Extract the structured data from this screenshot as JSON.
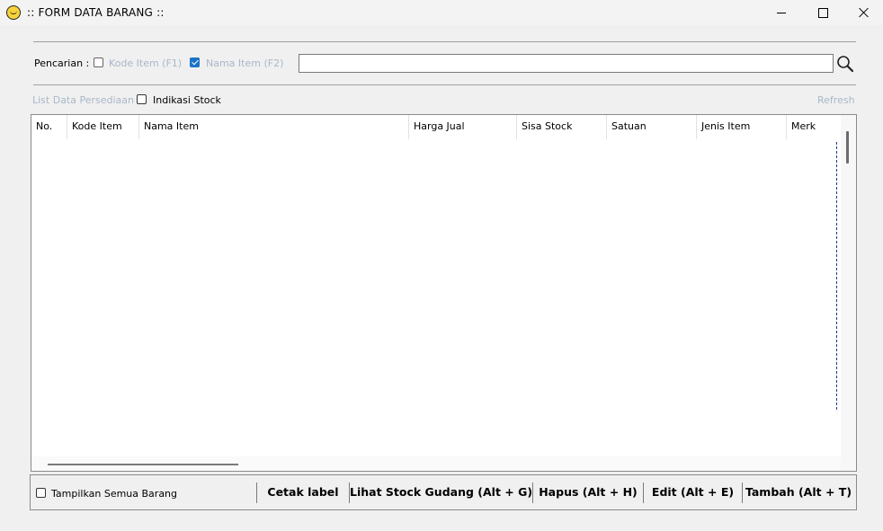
{
  "window": {
    "title": ":: FORM DATA BARANG ::",
    "controls": {
      "minimize": "minimize-icon",
      "maximize": "maximize-icon",
      "close": "close-icon"
    }
  },
  "search": {
    "label": "Pencarian :",
    "options": [
      {
        "label": "Kode Item (F1)",
        "checked": false
      },
      {
        "label": "Nama Item (F2)",
        "checked": true
      }
    ],
    "value": "",
    "placeholder": ""
  },
  "list": {
    "label": "List Data Persediaan :",
    "indikasi_label": "Indikasi Stock",
    "indikasi_checked": false,
    "refresh_label": "Refresh"
  },
  "table": {
    "columns": [
      "No.",
      "Kode Item",
      "Nama Item",
      "Harga Jual",
      "Sisa Stock",
      "Satuan",
      "Jenis Item",
      "Merk"
    ],
    "rows": []
  },
  "footer": {
    "show_all_label": "Tampilkan Semua Barang",
    "show_all_checked": false,
    "buttons": [
      "Cetak label",
      "Lihat Stock Gudang (Alt + G)",
      "Hapus (Alt + H)",
      "Edit (Alt + E)",
      "Tambah (Alt + T)"
    ]
  }
}
